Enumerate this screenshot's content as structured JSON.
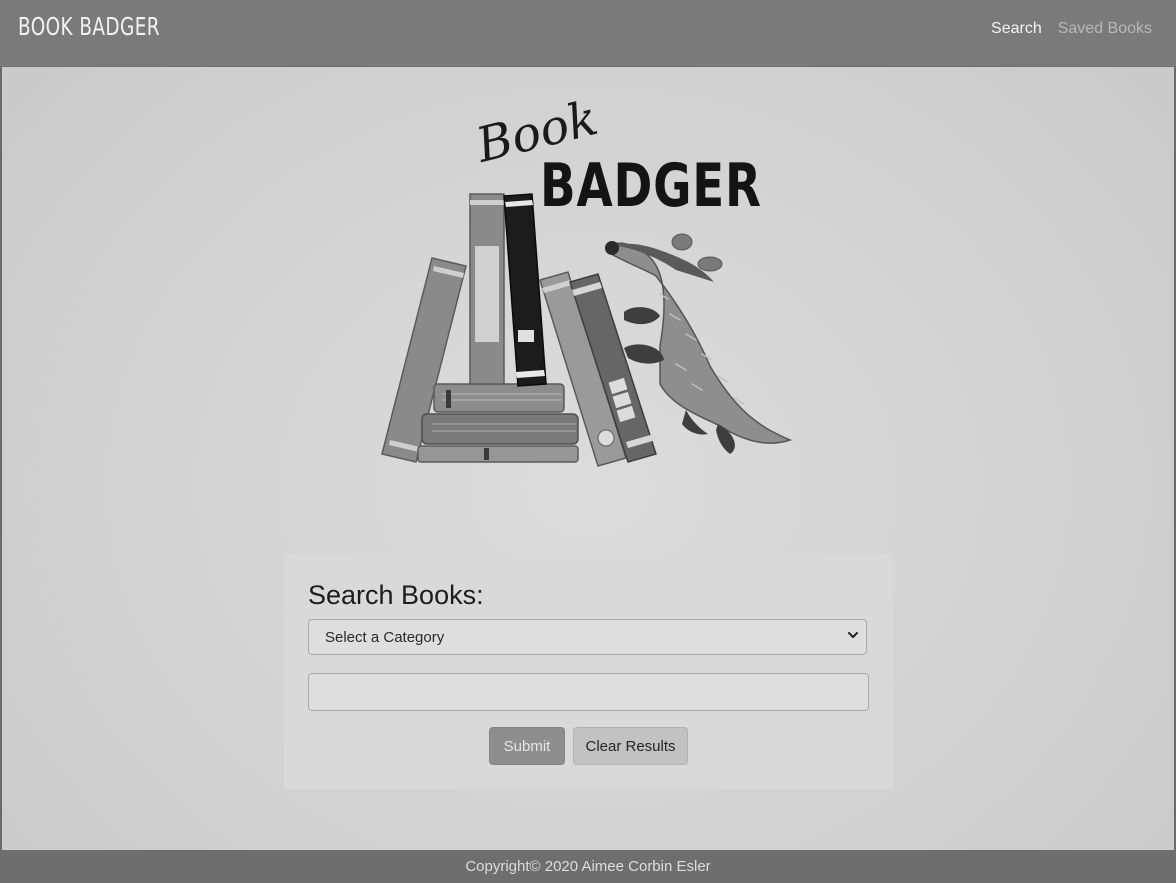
{
  "navbar": {
    "brand": "Book Badger",
    "links": [
      {
        "label": "Search"
      },
      {
        "label": "Saved Books"
      }
    ]
  },
  "logo": {
    "script_text": "Book",
    "word_text": "BADGER"
  },
  "search": {
    "title": "Search Books:",
    "category_select": {
      "selected": "Select a Category"
    },
    "query_input": {
      "value": "",
      "placeholder": ""
    },
    "submit_label": "Submit",
    "clear_label": "Clear Results"
  },
  "footer": {
    "copyright": "Copyright© 2020 Aimee Corbin Esler"
  },
  "colors": {
    "navbar_bg": "#7a7a7a",
    "footer_bg": "#6e6e6e",
    "page_bg": "#d2d2d2",
    "card_bg": "#d9d9d9",
    "submit_bg": "#8e8e8e",
    "clear_bg": "#c2c2c2"
  },
  "icons": {
    "select_caret": "chevron-down-icon"
  }
}
